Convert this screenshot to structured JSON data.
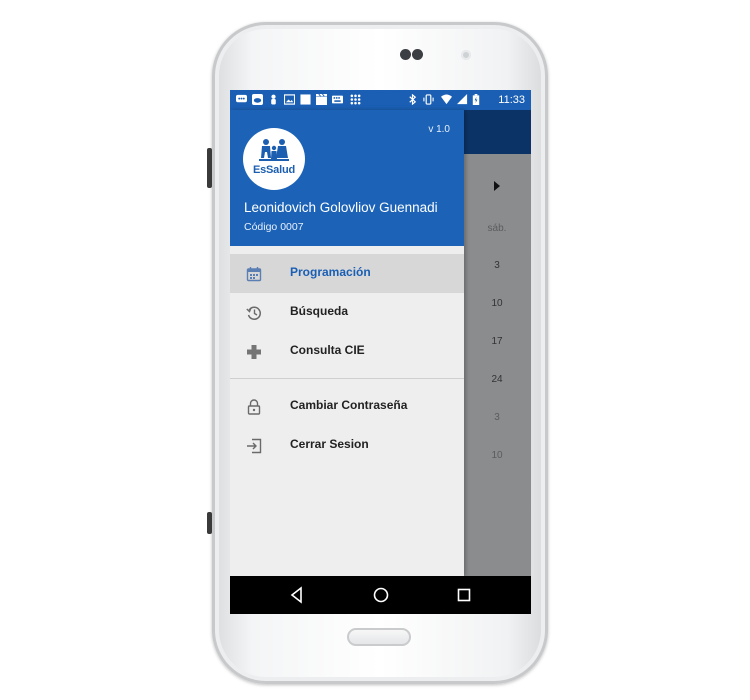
{
  "status_bar": {
    "time": "11:33",
    "icons_left": [
      "chat-icon",
      "cloud-icon",
      "person-icon",
      "image-icon",
      "square-icon",
      "clapperboard-icon",
      "keyboard-icon",
      "grid-icon"
    ],
    "icons_right": [
      "bluetooth-icon",
      "vibrate-icon",
      "wifi-icon",
      "signal-icon",
      "battery-icon"
    ]
  },
  "drawer": {
    "header": {
      "logo_text": "EsSalud",
      "version": "v 1.0",
      "user_name": "Leonidovich Golovliov Guennadi",
      "user_code": "Código 0007"
    },
    "menu": [
      {
        "label": "Programación",
        "icon": "calendar-icon",
        "active": true
      },
      {
        "label": "Búsqueda",
        "icon": "history-icon",
        "active": false
      },
      {
        "label": "Consulta CIE",
        "icon": "plus-icon",
        "active": false
      }
    ],
    "menu_secondary": [
      {
        "label": "Cambiar Contraseña",
        "icon": "lock-icon"
      },
      {
        "label": "Cerrar Sesion",
        "icon": "logout-icon"
      }
    ]
  },
  "background_calendar": {
    "day_header": "sáb.",
    "dates": [
      "3",
      "10",
      "17",
      "24",
      "3",
      "10"
    ]
  },
  "nav_bar": {
    "buttons": [
      "back-icon",
      "home-icon",
      "recents-icon"
    ]
  },
  "colors": {
    "header_blue": "#1c63b8",
    "status_blue": "#1a5fb4",
    "active_text": "#1a5fb4",
    "appbar_navy": "#0c3366"
  }
}
